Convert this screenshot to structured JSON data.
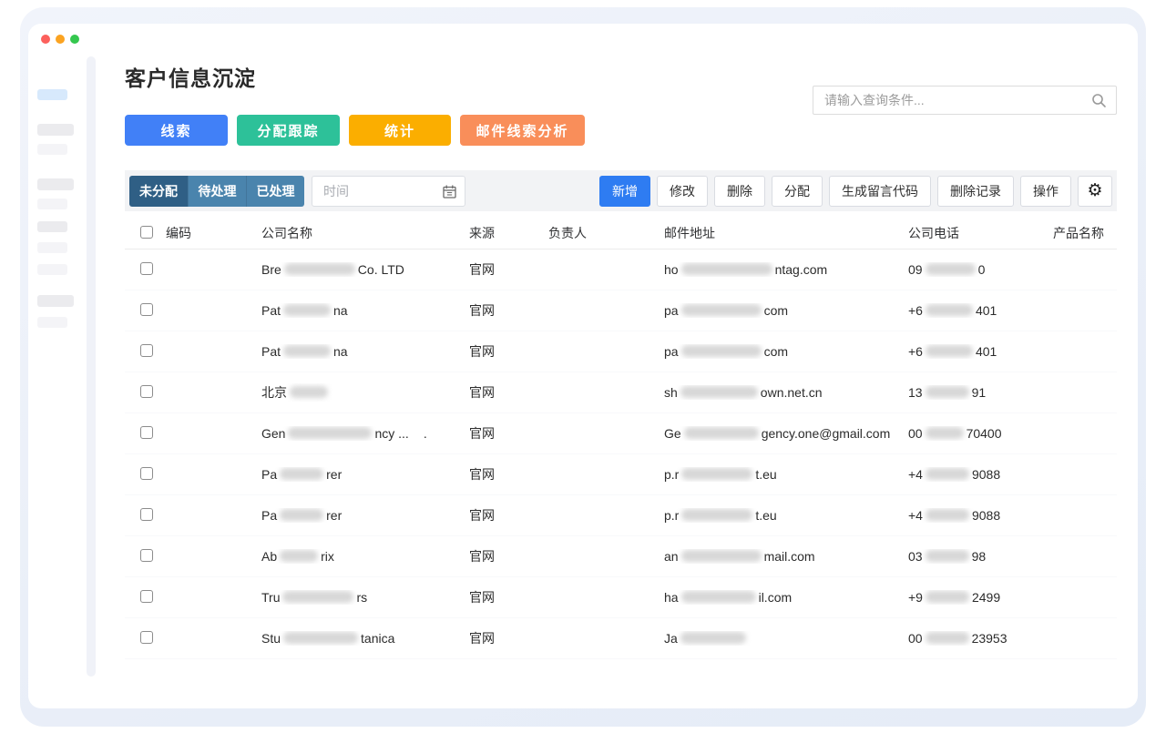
{
  "window": {
    "traffic_light_colors": [
      "#fc605c",
      "#fba321",
      "#34c74e"
    ]
  },
  "page": {
    "title": "客户信息沉淀"
  },
  "search": {
    "placeholder": "请输入查询条件..."
  },
  "nav_buttons": [
    {
      "label": "线索",
      "color": "#4180f7"
    },
    {
      "label": "分配跟踪",
      "color": "#2dc199"
    },
    {
      "label": "统计",
      "color": "#fbae00"
    },
    {
      "label": "邮件线索分析",
      "color": "#f98e5a"
    }
  ],
  "filter": {
    "tabs": [
      {
        "label": "未分配",
        "active": true,
        "color": "#2f5f85"
      },
      {
        "label": "待处理",
        "active": false,
        "color": "#4a84ad"
      },
      {
        "label": "已处理",
        "active": false,
        "color": "#4a84ad"
      }
    ],
    "date_placeholder": "时间"
  },
  "toolbar": {
    "buttons": [
      {
        "label": "新增",
        "primary": true,
        "color": "#2e7cf2"
      },
      {
        "label": "修改"
      },
      {
        "label": "删除"
      },
      {
        "label": "分配"
      },
      {
        "label": "生成留言代码"
      },
      {
        "label": "删除记录"
      },
      {
        "label": "操作"
      }
    ]
  },
  "icons": {
    "gear": "⚙"
  },
  "table": {
    "columns": [
      "编码",
      "公司名称",
      "来源",
      "负责人",
      "邮件地址",
      "公司电话",
      "产品名称"
    ],
    "rows": [
      {
        "code": "",
        "company": {
          "pre": "Bre",
          "post": "Co. LTD",
          "tail": ""
        },
        "source": "官网",
        "owner": "",
        "email": {
          "pre": "ho",
          "post": "ntag.com"
        },
        "phone": {
          "pre": "09",
          "post": "0"
        },
        "product": ""
      },
      {
        "code": "",
        "company": {
          "pre": "Pat",
          "post": "na",
          "tail": ""
        },
        "source": "官网",
        "owner": "",
        "email": {
          "pre": "pa",
          "post": "com"
        },
        "phone": {
          "pre": "+6",
          "post": "401"
        },
        "product": ""
      },
      {
        "code": "",
        "company": {
          "pre": "Pat",
          "post": "na",
          "tail": ""
        },
        "source": "官网",
        "owner": "",
        "email": {
          "pre": "pa",
          "post": "com"
        },
        "phone": {
          "pre": "+6",
          "post": "401"
        },
        "product": ""
      },
      {
        "code": "",
        "company": {
          "pre": "北京",
          "post": "",
          "tail": ""
        },
        "source": "官网",
        "owner": "",
        "email": {
          "pre": "sh",
          "post": "own.net.cn"
        },
        "phone": {
          "pre": "13",
          "post": "91"
        },
        "product": ""
      },
      {
        "code": "",
        "company": {
          "pre": "Gen",
          "post": "ncy ...",
          "tail": "."
        },
        "source": "官网",
        "owner": "",
        "email": {
          "pre": "Ge",
          "post": "gency.one@gmail.com"
        },
        "phone": {
          "pre": "00",
          "post": "70400"
        },
        "product": ""
      },
      {
        "code": "",
        "company": {
          "pre": "Pa",
          "post": "rer",
          "tail": ""
        },
        "source": "官网",
        "owner": "",
        "email": {
          "pre": "p.r",
          "post": "t.eu"
        },
        "phone": {
          "pre": "+4",
          "post": "9088"
        },
        "product": ""
      },
      {
        "code": "",
        "company": {
          "pre": "Pa",
          "post": "rer",
          "tail": ""
        },
        "source": "官网",
        "owner": "",
        "email": {
          "pre": "p.r",
          "post": "t.eu"
        },
        "phone": {
          "pre": "+4",
          "post": "9088"
        },
        "product": ""
      },
      {
        "code": "",
        "company": {
          "pre": "Ab",
          "post": "rix",
          "tail": ""
        },
        "source": "官网",
        "owner": "",
        "email": {
          "pre": "an",
          "post": "mail.com"
        },
        "phone": {
          "pre": "03",
          "post": "98"
        },
        "product": ""
      },
      {
        "code": "",
        "company": {
          "pre": "Tru",
          "post": "rs",
          "tail": ""
        },
        "source": "官网",
        "owner": "",
        "email": {
          "pre": "ha",
          "post": "il.com"
        },
        "phone": {
          "pre": "+9",
          "post": "2499"
        },
        "product": ""
      },
      {
        "code": "",
        "company": {
          "pre": "Stu",
          "post": "tanica",
          "tail": ""
        },
        "source": "官网",
        "owner": "",
        "email": {
          "pre": "Ja",
          "post": ""
        },
        "phone": {
          "pre": "00",
          "post": "23953"
        },
        "product": ""
      }
    ]
  }
}
